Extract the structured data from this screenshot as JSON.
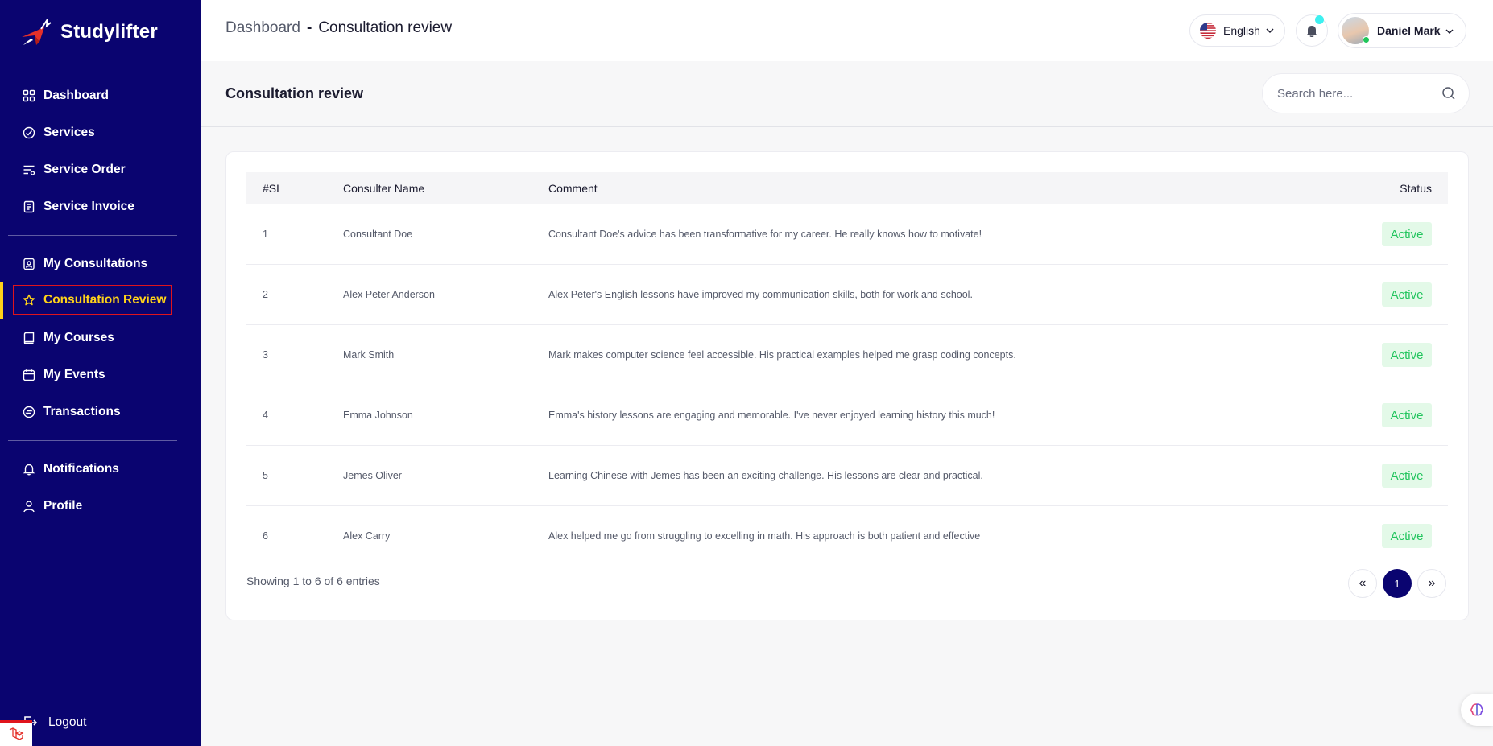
{
  "brand": {
    "name": "Studylifter"
  },
  "sidebar": {
    "groups": [
      {
        "items": [
          {
            "label": "Dashboard",
            "icon": "dashboard-icon"
          },
          {
            "label": "Services",
            "icon": "services-icon"
          },
          {
            "label": "Service Order",
            "icon": "service-order-icon"
          },
          {
            "label": "Service Invoice",
            "icon": "invoice-icon"
          }
        ]
      },
      {
        "items": [
          {
            "label": "My Consultations",
            "icon": "consultations-icon"
          },
          {
            "label": "Consultation Review",
            "icon": "star-icon",
            "active": true
          },
          {
            "label": "My Courses",
            "icon": "courses-icon"
          },
          {
            "label": "My Events",
            "icon": "calendar-icon"
          },
          {
            "label": "Transactions",
            "icon": "transactions-icon"
          }
        ]
      },
      {
        "items": [
          {
            "label": "Notifications",
            "icon": "bell-icon"
          },
          {
            "label": "Profile",
            "icon": "user-icon"
          }
        ]
      }
    ],
    "logout": "Logout"
  },
  "header": {
    "breadcrumb": {
      "root": "Dashboard",
      "separator": "-",
      "current": "Consultation review"
    },
    "language": "English",
    "user": {
      "name": "Daniel Mark"
    }
  },
  "page": {
    "title": "Consultation review",
    "search_placeholder": "Search here..."
  },
  "table": {
    "columns": [
      "#SL",
      "Consulter Name",
      "Comment",
      "Status"
    ],
    "rows": [
      {
        "sl": "1",
        "name": "Consultant Doe",
        "comment": "Consultant Doe's advice has been transformative for my career. He really knows how to motivate!",
        "status": "Active"
      },
      {
        "sl": "2",
        "name": "Alex Peter Anderson",
        "comment": "Alex Peter's English lessons have improved my communication skills, both for work and school.",
        "status": "Active"
      },
      {
        "sl": "3",
        "name": "Mark Smith",
        "comment": "Mark makes computer science feel accessible. His practical examples helped me grasp coding concepts.",
        "status": "Active"
      },
      {
        "sl": "4",
        "name": "Emma Johnson",
        "comment": "Emma's history lessons are engaging and memorable. I've never enjoyed learning history this much!",
        "status": "Active"
      },
      {
        "sl": "5",
        "name": "Jemes Oliver",
        "comment": "Learning Chinese with Jemes has been an exciting challenge. His lessons are clear and practical.",
        "status": "Active"
      },
      {
        "sl": "6",
        "name": "Alex Carry",
        "comment": "Alex helped me go from struggling to excelling in math. His approach is both patient and effective",
        "status": "Active"
      }
    ],
    "footer": "Showing 1 to 6 of 6 entries",
    "pagination": {
      "prev": "«",
      "current": "1",
      "next": "»"
    }
  },
  "colors": {
    "sidebar_bg": "#0a0470",
    "active_text": "#ffd21a",
    "highlight_border": "#e0141c",
    "status_active": "#22c55e"
  }
}
